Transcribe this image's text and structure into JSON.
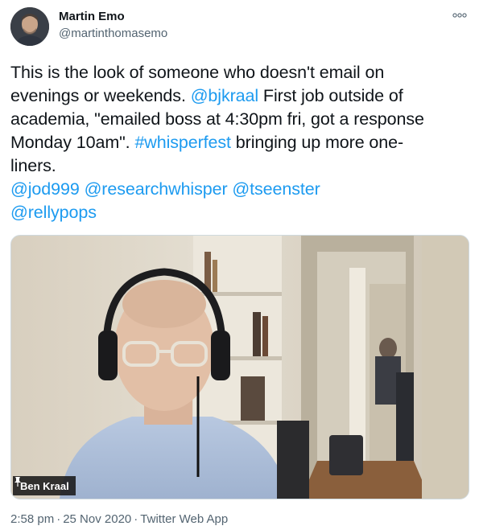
{
  "author": {
    "display_name": "Martin Emo",
    "handle": "@martinthomasemo",
    "avatar_icon": "profile-photo"
  },
  "more_icon": "ellipsis-icon",
  "tweet": {
    "line1": "This is the look of someone who doesn't email on",
    "line2_text": "evenings or weekends. ",
    "mention_bjkraal": "@bjkraal",
    "line2_tail": " First job outside of",
    "line3": "academia, \"emailed boss at 4:30pm fri, got a response",
    "line4_head": "Monday 10am\". ",
    "hashtag": "#whisperfest",
    "line4_tail": " bringing up more one-",
    "line5": "liners.",
    "mentions_line1": [
      "@jod999",
      "@researchwhisper",
      "@tseenster"
    ],
    "mentions_line2": [
      "@rellypops"
    ]
  },
  "media": {
    "participant_name": "Ben Kraal",
    "pin_icon": "pin-icon"
  },
  "meta": {
    "time": "2:58 pm",
    "date": "25 Nov 2020",
    "source": "Twitter Web App",
    "separator": "·"
  },
  "colors": {
    "link": "#1d9bf0",
    "text": "#0f1419",
    "secondary": "#536471"
  }
}
